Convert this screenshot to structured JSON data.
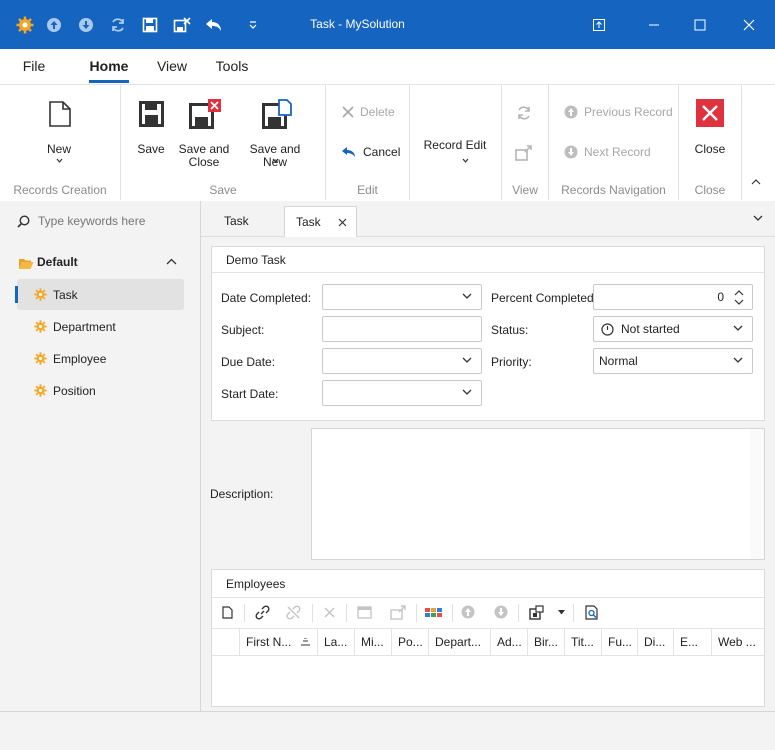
{
  "window": {
    "title": "Task - MySolution",
    "accent": "#1565c0"
  },
  "quick_access": {
    "icons": [
      "app-gear-icon",
      "arrow-up-circle-icon",
      "arrow-down-circle-icon",
      "refresh-icon",
      "save-icon",
      "save-and-close-icon",
      "undo-icon",
      "customize-dropdown-icon"
    ]
  },
  "menu": {
    "file": "File",
    "home": "Home",
    "view": "View",
    "tools": "Tools"
  },
  "ribbon": {
    "new_label": "New",
    "records_creation_label": "Records Creation",
    "save_label": "Save",
    "save_and_close_label": "Save and Close",
    "save_and_new_label": "Save and New",
    "save_group_label": "Save",
    "delete_label": "Delete",
    "cancel_label": "Cancel",
    "edit_group_label": "Edit",
    "record_edit_label": "Record Edit",
    "view_group_label": "View",
    "previous_record_label": "Previous Record",
    "next_record_label": "Next Record",
    "records_navigation_label": "Records Navigation",
    "close_label": "Close",
    "close_group_label": "Close"
  },
  "sidebar": {
    "search_placeholder": "Type keywords here",
    "group_label": "Default",
    "items": [
      {
        "label": "Task",
        "selected": true
      },
      {
        "label": "Department",
        "selected": false
      },
      {
        "label": "Employee",
        "selected": false
      },
      {
        "label": "Position",
        "selected": false
      }
    ]
  },
  "doc_tabs": [
    {
      "label": "Task",
      "active": false
    },
    {
      "label": "Task",
      "active": true
    }
  ],
  "form": {
    "group_title": "Demo Task",
    "date_completed_label": "Date Completed:",
    "date_completed_value": "",
    "subject_label": "Subject:",
    "subject_value": "",
    "due_date_label": "Due Date:",
    "due_date_value": "",
    "start_date_label": "Start Date:",
    "start_date_value": "",
    "percent_completed_label": "Percent Completed:",
    "percent_completed_value": "0",
    "status_label": "Status:",
    "status_value": "Not started",
    "priority_label": "Priority:",
    "priority_value": "Normal",
    "description_label": "Description:",
    "description_value": ""
  },
  "employees": {
    "title": "Employees",
    "columns": [
      "First N...",
      "La...",
      "Mi...",
      "Po...",
      "Depart...",
      "Ad...",
      "Bir...",
      "Tit...",
      "Fu...",
      "Di...",
      "E...",
      "Web ..."
    ]
  }
}
